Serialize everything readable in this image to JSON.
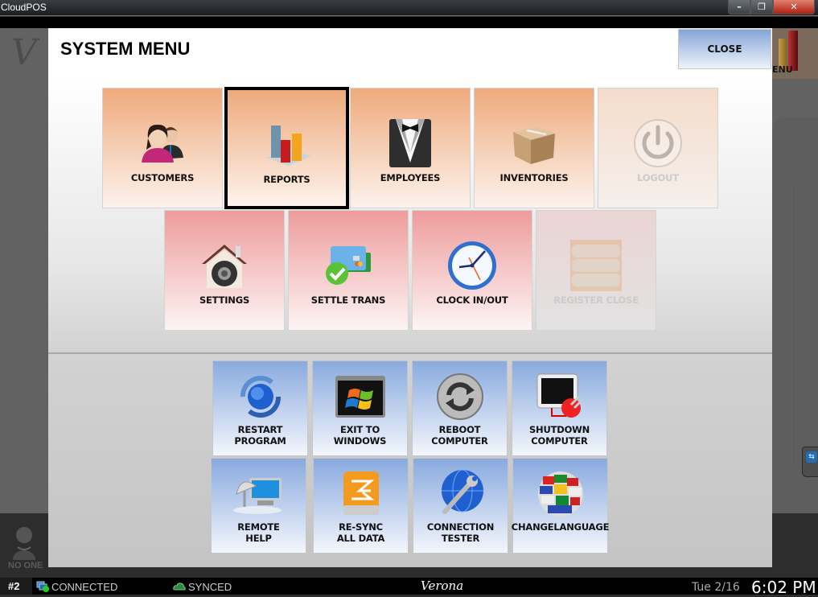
{
  "window": {
    "title": "CloudPOS",
    "controls": {
      "minimize": "–",
      "restore": "❐",
      "close": "✕"
    }
  },
  "background": {
    "logo_letter": "V",
    "menu_tile_label": "ENU",
    "user": {
      "name": "NO ONE"
    }
  },
  "dialog": {
    "title": "SYSTEM MENU",
    "close_label": "CLOSE",
    "primary_row1": [
      {
        "id": "customers",
        "label": "CUSTOMERS",
        "icon": "customers-icon",
        "enabled": true,
        "selected": false
      },
      {
        "id": "reports",
        "label": "REPORTS",
        "icon": "bar-chart-icon",
        "enabled": true,
        "selected": true
      },
      {
        "id": "employees",
        "label": "EMPLOYEES",
        "icon": "tuxedo-icon",
        "enabled": true,
        "selected": false
      },
      {
        "id": "inventories",
        "label": "INVENTORIES",
        "icon": "box-icon",
        "enabled": true,
        "selected": false
      },
      {
        "id": "logout",
        "label": "LOGOUT",
        "icon": "power-icon",
        "enabled": false,
        "selected": false
      }
    ],
    "primary_row2": [
      {
        "id": "settings",
        "label": "SETTINGS",
        "icon": "gear-house-icon",
        "enabled": true
      },
      {
        "id": "settle-trans",
        "label": "SETTLE TRANS",
        "icon": "credit-card-check-icon",
        "enabled": true
      },
      {
        "id": "clock-in-out",
        "label": "CLOCK IN/OUT",
        "icon": "clock-icon",
        "enabled": true
      },
      {
        "id": "register-close",
        "label": "REGISTER CLOSE",
        "icon": "coin-rolls-icon",
        "enabled": false
      }
    ],
    "system_row1": [
      {
        "id": "restart-program",
        "label_lines": [
          "RESTART",
          "PROGRAM"
        ],
        "icon": "restart-globe-icon"
      },
      {
        "id": "exit-to-windows",
        "label_lines": [
          "EXIT TO",
          "WINDOWS"
        ],
        "icon": "windows-icon"
      },
      {
        "id": "reboot-computer",
        "label_lines": [
          "REBOOT",
          "COMPUTER"
        ],
        "icon": "reboot-icon"
      },
      {
        "id": "shutdown-computer",
        "label_lines": [
          "SHUTDOWN",
          "COMPUTER"
        ],
        "icon": "monitor-unplug-icon"
      }
    ],
    "system_row2": [
      {
        "id": "remote-help",
        "label_lines": [
          "REMOTE",
          "HELP"
        ],
        "icon": "remote-help-icon"
      },
      {
        "id": "re-sync-all-data",
        "label_lines": [
          "RE-SYNC",
          "ALL DATA"
        ],
        "icon": "sync-drive-icon"
      },
      {
        "id": "connection-tester",
        "label_lines": [
          "CONNECTION",
          "TESTER"
        ],
        "icon": "globe-wrench-icon"
      },
      {
        "id": "change-language",
        "label_lines": [
          "CHANGELANGUAGE"
        ],
        "icon": "flags-globe-icon"
      }
    ]
  },
  "statusbar": {
    "station": "#2",
    "connection": "CONNECTED",
    "sync": "SYNCED",
    "brand": "Verona",
    "date": "Tue 2/16",
    "time": "6:02 PM"
  },
  "colors": {
    "orange_tile_top": "#eeaa7c",
    "pink_tile_top": "#ee9c9c",
    "blue_tile_top": "#89aadf",
    "selected_border": "#000000"
  }
}
